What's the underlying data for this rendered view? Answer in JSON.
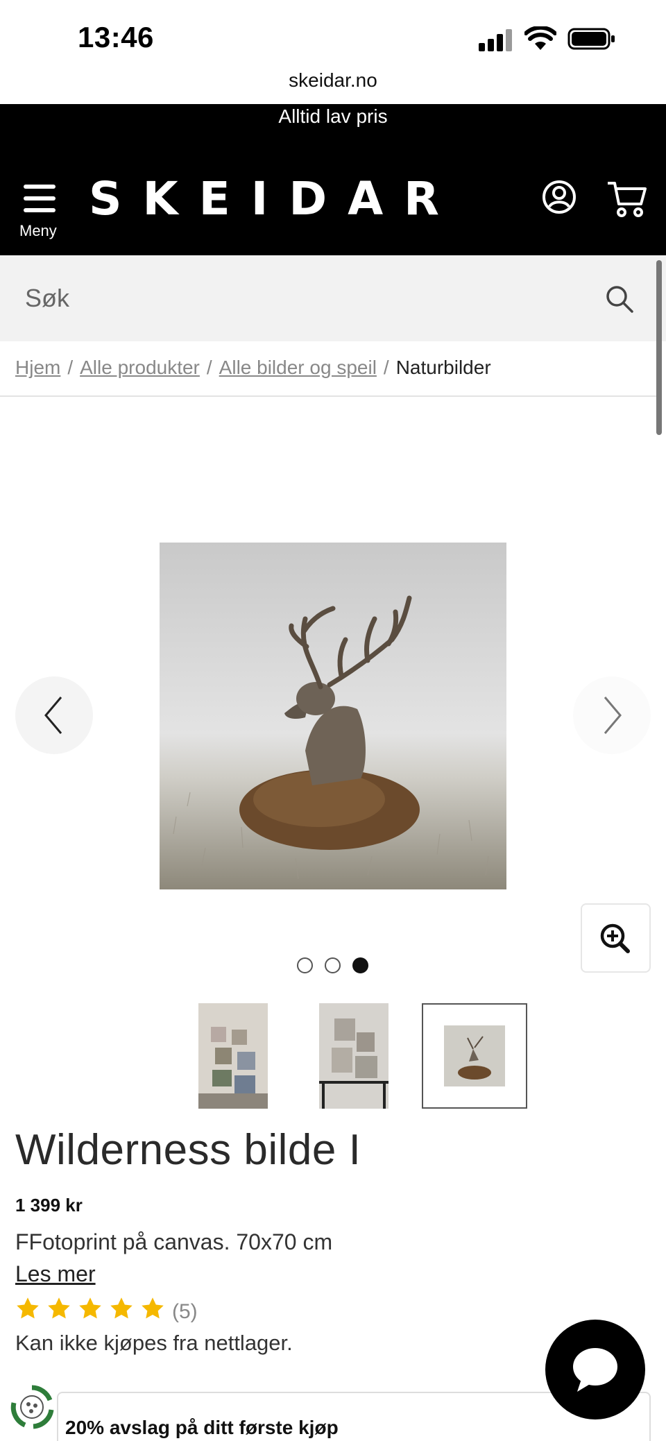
{
  "status_bar": {
    "time": "13:46"
  },
  "browser": {
    "url": "skeidar.no"
  },
  "promo": {
    "text": "Alltid lav pris"
  },
  "header": {
    "menu_label": "Meny",
    "logo": "SKEIDAR"
  },
  "search": {
    "placeholder": "Søk"
  },
  "breadcrumb": {
    "items": [
      "Hjem",
      "Alle produkter",
      "Alle bilder og speil"
    ],
    "current": "Naturbilder",
    "separator": "/"
  },
  "gallery": {
    "image_count": 3,
    "active_index": 2
  },
  "product": {
    "title": "Wilderness bilde I",
    "price": "1 399 kr",
    "description": "FFotoprint på canvas. 70x70 cm",
    "read_more": "Les mer",
    "rating_stars": 5,
    "review_count": "(5)",
    "availability": "Kan ikke kjøpes fra nettlager."
  },
  "discount_banner": {
    "text": "20% avslag på ditt første kjøp"
  },
  "colors": {
    "header_bg": "#000000",
    "star": "#F5B800",
    "eco_green": "#2E7D3A"
  },
  "icons": [
    "hamburger-icon",
    "user-icon",
    "cart-icon",
    "search-icon",
    "chevron-left-icon",
    "chevron-right-icon",
    "zoom-in-icon",
    "star-icon",
    "chat-icon",
    "eco-icon"
  ]
}
